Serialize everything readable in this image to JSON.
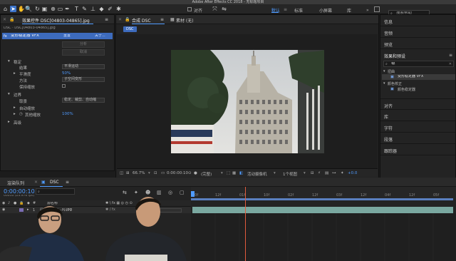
{
  "window": {
    "title": "Adobe After Effects CC 2018 - 无标题项目"
  },
  "toolbar": {
    "align_label": "对齐",
    "workspaces": [
      "默认",
      "标准",
      "小屏幕",
      "库"
    ],
    "active_workspace": "默认",
    "search_placeholder": "搜索帮助"
  },
  "effect_controls": {
    "tab_label": "效果控件 DSC[04803-04865].jpg",
    "breadcrumb": "DSC · DSC[04803-04865].jpg",
    "effect_name": "变形稳定器 VFX",
    "reset_label": "重置",
    "about_label": "关于...",
    "analyze_label": "分析",
    "cancel_label": "取消",
    "section_stabilize": "稳定",
    "result_label": "结果",
    "result_value": "平滑运动",
    "smoothness_label": "平滑度",
    "smoothness_value": "50%",
    "method_label": "方法",
    "method_value": "子空间变形",
    "keep_scale_label": "保持缩放",
    "section_borders": "边界",
    "framing_label": "取景",
    "framing_value": "稳定、裁剪、自动缩",
    "auto_scale_label": "自动缩放",
    "other_scale_label": "其他缩放",
    "other_scale_value": "100%",
    "section_advanced": "高级"
  },
  "composition": {
    "tab_label": "合成 DSC",
    "footage_tab_label": "素材 (无)",
    "comp_chip": "DSC",
    "viewbar": {
      "zoom": "66.7%",
      "timecode": "0:00:00:10",
      "resolution": "(完整)",
      "camera": "活动摄像机",
      "views": "1个视图",
      "exposure": "+0.0"
    }
  },
  "right_panels": {
    "info": "信息",
    "audio": "音频",
    "preview": "预览",
    "effects_presets": "效果和预设",
    "search_value": "稳",
    "dist_group": "扭曲",
    "dist_item": "变形稳定器 VFX",
    "color_group": "颜色校正",
    "color_item": "颜色稳定器",
    "align": "对齐",
    "library": "库",
    "characters": "字符",
    "paragraph": "段落",
    "tracker": "跟踪器"
  },
  "timeline": {
    "render_queue_tab": "渲染队列",
    "comp_tab": "DSC",
    "timecode": "0:00:00:10",
    "frame_info": "00010 (23.976 fps)",
    "search_placeholder": "",
    "col_name": "源名称",
    "col_parent": "父级",
    "layer_number": "1",
    "layer_name": "DSC[0...3].jpg",
    "ruler_ticks": [
      "00f",
      "12f",
      "01f",
      "10f",
      "02f",
      "12f",
      "03f",
      "12f",
      "04f",
      "12f",
      "05f"
    ]
  }
}
